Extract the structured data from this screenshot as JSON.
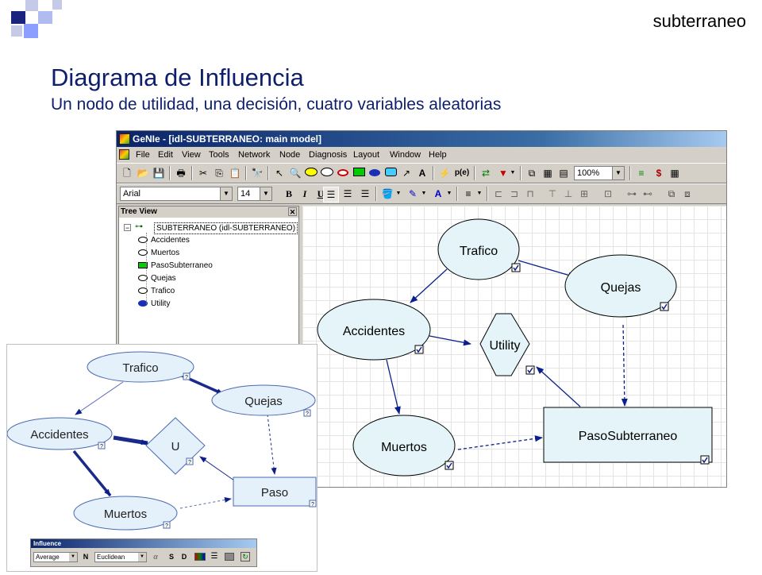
{
  "slide": {
    "header_word": "subterraneo",
    "title": "Diagrama de Influencia",
    "subtitle": "Un nodo de utilidad, una decisión, cuatro variables aleatorias"
  },
  "window": {
    "title": "GeNIe - [idl-SUBTERRANEO: main model]",
    "menu": [
      "File",
      "Edit",
      "View",
      "Tools",
      "Network",
      "Node",
      "Diagnosis",
      "Layout",
      "Window",
      "Help"
    ],
    "zoom": "100%",
    "font_name": "Arial",
    "font_size": "14",
    "bold_label": "B",
    "italic_label": "I",
    "underline_label": "U",
    "text_tool_label": "A",
    "prob_label": "p(e)",
    "dollar_label": "$"
  },
  "tree_view": {
    "title": "Tree View",
    "root": "SUBTERRANEO  (idl-SUBTERRANEO)",
    "items": [
      {
        "label": "Accidentes",
        "icon": "chance-oval-icon"
      },
      {
        "label": "Muertos",
        "icon": "chance-oval-icon"
      },
      {
        "label": "PasoSubterraneo",
        "icon": "decision-rect-icon"
      },
      {
        "label": "Quejas",
        "icon": "chance-oval-icon"
      },
      {
        "label": "Trafico",
        "icon": "chance-oval-icon"
      },
      {
        "label": "Utility",
        "icon": "utility-hexagon-icon"
      }
    ]
  },
  "main_model": {
    "nodes": {
      "trafico": "Trafico",
      "quejas": "Quejas",
      "accidentes": "Accidentes",
      "utility": "Utility",
      "muertos": "Muertos",
      "paso": "PasoSubterraneo"
    }
  },
  "second_model": {
    "nodes": {
      "trafico": "Trafico",
      "quejas": "Quejas",
      "accidentes": "Accidentes",
      "utility": "U",
      "muertos": "Muertos",
      "paso": "Paso"
    },
    "node_marker": "?"
  },
  "influence_bar": {
    "title": "Influence",
    "mode": "Average",
    "n_label": "N",
    "distance": "Euclidean",
    "alpha": "α",
    "s_label": "S",
    "d_label": "D"
  },
  "colors": {
    "node_fill": "#e4f4f8",
    "node_border": "#000000",
    "arc": "#0b1f8a",
    "title_text": "#0d1f6a",
    "logo_dark": "#1a237e",
    "logo_light": "#8c9eff"
  }
}
